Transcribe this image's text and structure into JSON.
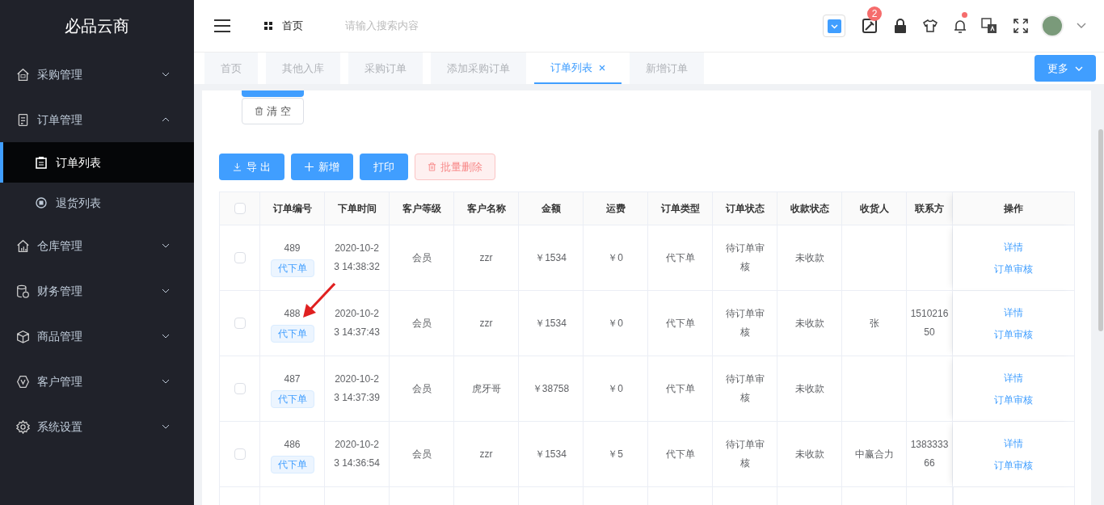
{
  "sidebar": {
    "logo": "必品云商",
    "items": [
      {
        "label": "采购管理",
        "expanded": false
      },
      {
        "label": "订单管理",
        "expanded": true,
        "children": [
          {
            "label": "订单列表",
            "selected": true
          },
          {
            "label": "退货列表",
            "selected": false
          }
        ]
      },
      {
        "label": "仓库管理",
        "expanded": false
      },
      {
        "label": "财务管理",
        "expanded": false
      },
      {
        "label": "商品管理",
        "expanded": false
      },
      {
        "label": "客户管理",
        "expanded": false
      },
      {
        "label": "系统设置",
        "expanded": false
      }
    ]
  },
  "header": {
    "breadcrumb": "首页",
    "search": {
      "placeholder": "请输入搜索内容"
    },
    "tools_badge": "2",
    "bell_dot": true
  },
  "tabs": [
    {
      "label": "首页",
      "selected": false
    },
    {
      "label": "其他入库",
      "selected": false
    },
    {
      "label": "采购订单",
      "selected": false
    },
    {
      "label": "添加采购订单",
      "selected": false
    },
    {
      "label": "订单列表",
      "selected": true
    },
    {
      "label": "新增订单",
      "selected": false
    }
  ],
  "more_button": "更多",
  "clear_button": "清 空",
  "toolbar": [
    {
      "label": "导 出",
      "kind": "export"
    },
    {
      "label": "新增",
      "kind": "add"
    },
    {
      "label": "打印",
      "kind": "print"
    },
    {
      "label": "批量删除",
      "kind": "delete"
    }
  ],
  "table": {
    "select_all": false,
    "columns": [
      "订单编号",
      "下单时间",
      "客户等级",
      "客户名称",
      "金额",
      "运费",
      "订单类型",
      "订单状态",
      "收款状态",
      "收货人",
      "联系方",
      "操作"
    ],
    "rows": [
      {
        "checked": false,
        "cells": [
          "489",
          "2020-10-23 14:38:32",
          "会员",
          "zzr",
          "￥1534",
          "￥0",
          "代下单",
          "待订单审核",
          "未收款",
          "",
          ""
        ],
        "tag": "代下单",
        "actions": [
          "详情",
          "订单审核"
        ]
      },
      {
        "checked": false,
        "cells": [
          "488",
          "2020-10-23 14:37:43",
          "会员",
          "zzr",
          "￥1534",
          "￥0",
          "代下单",
          "待订单审核",
          "未收款",
          "张",
          "151021650"
        ],
        "tag": "代下单",
        "actions": [
          "详情",
          "订单审核"
        ]
      },
      {
        "checked": false,
        "cells": [
          "487",
          "2020-10-23 14:37:39",
          "会员",
          "虎牙哥",
          "￥38758",
          "￥0",
          "代下单",
          "待订单审核",
          "未收款",
          "",
          ""
        ],
        "tag": "代下单",
        "actions": [
          "详情",
          "订单审核"
        ]
      },
      {
        "checked": false,
        "cells": [
          "486",
          "2020-10-23 14:36:54",
          "会员",
          "zzr",
          "￥1534",
          "￥5",
          "代下单",
          "待订单审核",
          "未收款",
          "中赢合力",
          "138333366"
        ],
        "tag": "代下单",
        "actions": [
          "详情",
          "订单审核"
        ]
      }
    ]
  }
}
